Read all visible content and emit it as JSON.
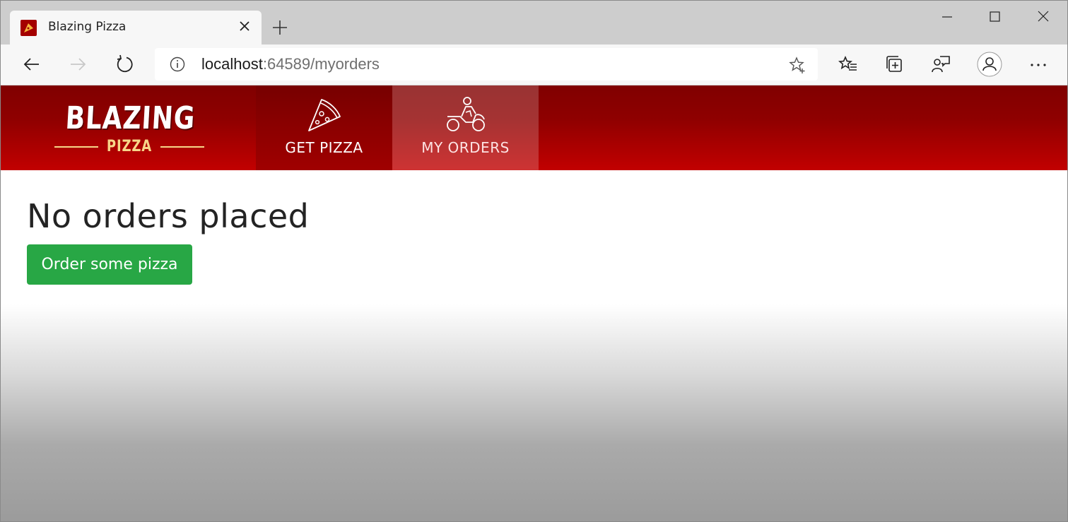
{
  "browser": {
    "tab_title": "Blazing Pizza",
    "url_host": "localhost",
    "url_rest": ":64589/myorders",
    "icons": {
      "favicon": "pizza-favicon",
      "tab_close": "close-icon",
      "new_tab": "plus-icon",
      "minimize": "minimize-icon",
      "maximize": "maximize-icon",
      "close_window": "close-icon",
      "back": "back-arrow-icon",
      "forward": "forward-arrow-icon",
      "refresh": "refresh-icon",
      "site_info": "info-icon",
      "add_favorite": "star-plus-icon",
      "favorites": "favorites-icon",
      "collections": "collections-icon",
      "feedback": "feedback-icon",
      "profile": "profile-icon",
      "more": "more-icon"
    }
  },
  "site": {
    "logo_word": "BLAZING",
    "logo_sub": "PIZZA",
    "nav": [
      {
        "label": "GET PIZZA",
        "icon": "pizza-slice-icon",
        "active": false
      },
      {
        "label": "MY ORDERS",
        "icon": "motorbike-icon",
        "active": true
      }
    ],
    "heading": "No orders placed",
    "button_label": "Order some pizza",
    "colors": {
      "brand_red": "#c20000",
      "button_green": "#28a745"
    }
  }
}
